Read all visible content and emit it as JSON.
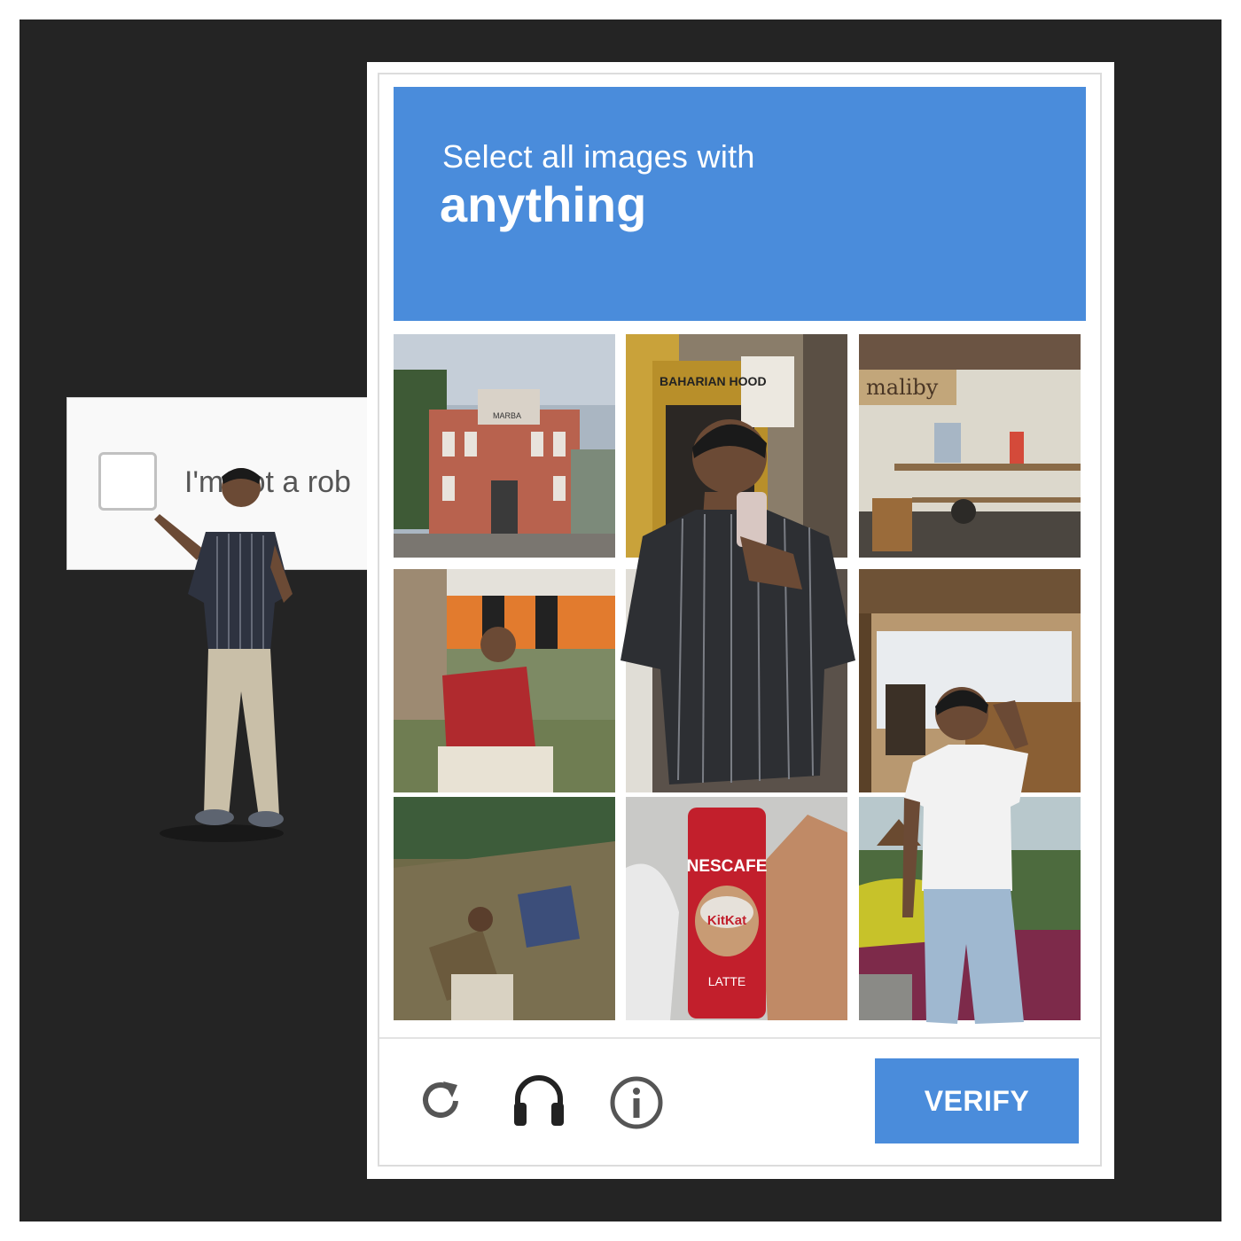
{
  "anchor": {
    "label": "I'm not a rob",
    "checked": false
  },
  "challenge": {
    "instruction": "Select all images with",
    "target": "anything",
    "tiles": [
      {
        "row": 1,
        "col": 1,
        "desc": "colonial building street",
        "sign": "MARBA"
      },
      {
        "row": 1,
        "col": 2,
        "desc": "person mirror selfie",
        "sign": "BAHARIAN HOOD"
      },
      {
        "row": 1,
        "col": 3,
        "desc": "coffee shop interior",
        "sign": "maliby"
      },
      {
        "row": 2,
        "col": 1,
        "desc": "person sitting outdoors"
      },
      {
        "row": 2,
        "col": 2,
        "desc": "person in striped shirt"
      },
      {
        "row": 2,
        "col": 3,
        "desc": "wooden cafe counter"
      },
      {
        "row": 3,
        "col": 1,
        "desc": "hikers resting on hill"
      },
      {
        "row": 3,
        "col": 2,
        "desc": "hand holding coffee can",
        "can_brand": "NESCAFE",
        "can_flavor": "LATTE",
        "can_logo": "KitKat"
      },
      {
        "row": 3,
        "col": 3,
        "desc": "person in garden"
      }
    ]
  },
  "footer": {
    "icons": [
      "reload-icon",
      "headphones-icon",
      "info-icon"
    ],
    "verify_label": "VERIFY"
  },
  "colors": {
    "accent": "#4a8cdb",
    "background": "#242424"
  }
}
